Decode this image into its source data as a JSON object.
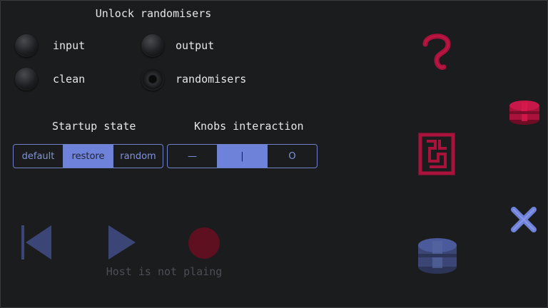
{
  "randomisers": {
    "title": "Unlock randomisers",
    "options": [
      {
        "label": "input",
        "on": false
      },
      {
        "label": "output",
        "on": false
      },
      {
        "label": "clean",
        "on": false
      },
      {
        "label": "randomisers",
        "on": true
      }
    ]
  },
  "startup_state": {
    "title": "Startup state",
    "options": [
      "default",
      "restore",
      "random"
    ],
    "selected": "restore"
  },
  "knobs_interaction": {
    "title": "Knobs interaction",
    "options": [
      "—",
      "|",
      "O"
    ],
    "selected": "|"
  },
  "transport": {
    "status": "Host is not plaing",
    "icons": [
      "rewind-icon",
      "play-icon",
      "record-icon"
    ]
  },
  "side_icons": [
    "help-icon",
    "maze-icon",
    "stack-icon",
    "close-icon",
    "cylinder-icon"
  ],
  "colors": {
    "background": "#1b1c1e",
    "accent": "#6f82d9",
    "crimson": "#b3123e",
    "dim_blue": "#4a5a9a"
  }
}
